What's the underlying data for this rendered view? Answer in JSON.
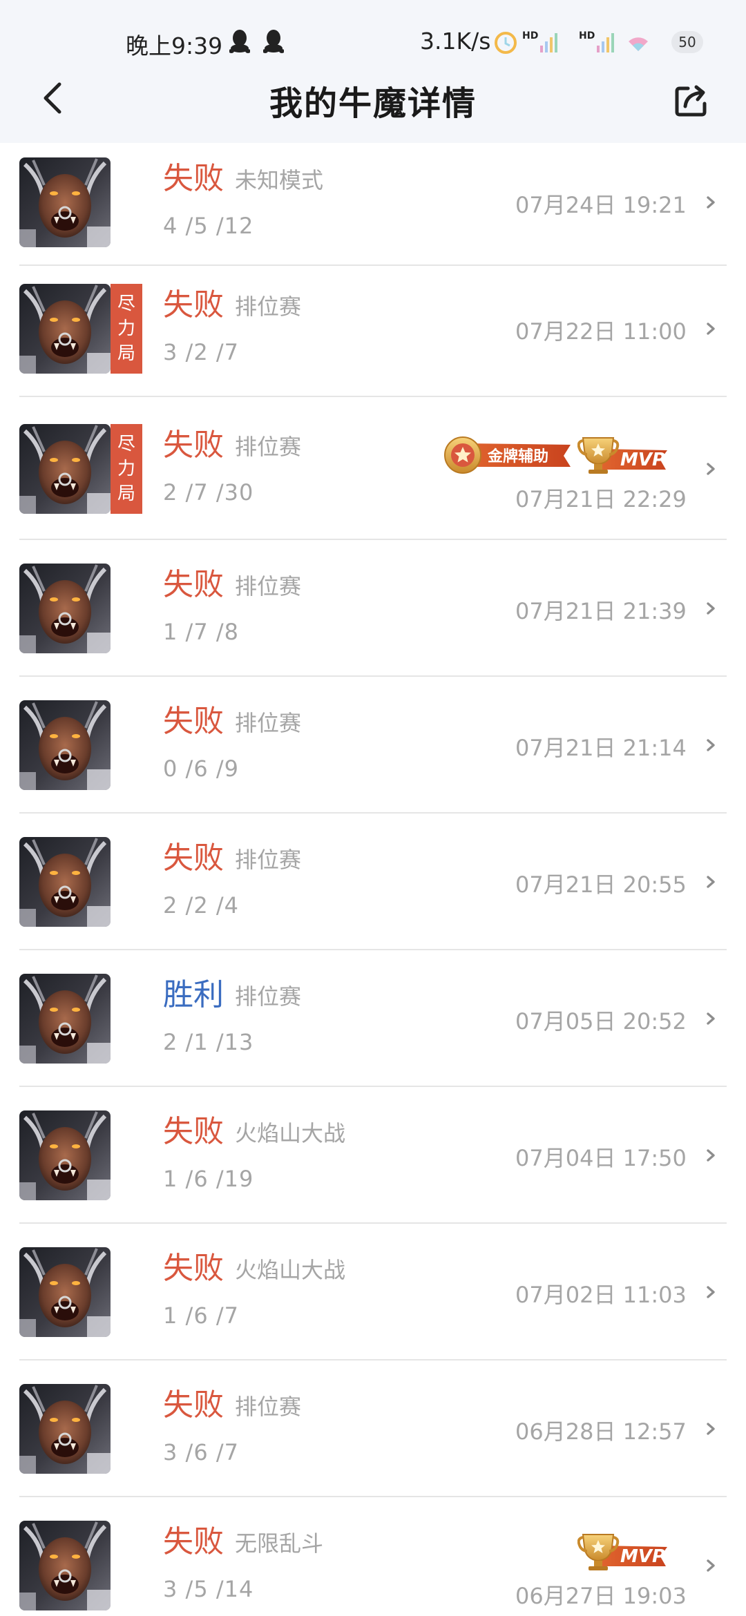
{
  "status_bar": {
    "time": "晚上9:39",
    "net_speed": "3.1K/s",
    "battery": "50"
  },
  "nav": {
    "title": "我的牛魔详情"
  },
  "badges": {
    "effort": [
      "尽",
      "力",
      "局"
    ],
    "gold_support": "金牌辅助",
    "mvp": "MVP"
  },
  "colors": {
    "loss": "#d9573e",
    "win": "#3a6cc0",
    "muted_text": "#a5a5a5",
    "header_bg": "#f4f6fa"
  },
  "matches": [
    {
      "result": "失败",
      "mode": "未知模式",
      "kda": "4 /5 /12",
      "datetime": "07月24日 19:21",
      "effort": false,
      "medals": []
    },
    {
      "result": "失败",
      "mode": "排位赛",
      "kda": "3 /2 /7",
      "datetime": "07月22日 11:00",
      "effort": true,
      "medals": []
    },
    {
      "result": "失败",
      "mode": "排位赛",
      "kda": "2 /7 /30",
      "datetime": "07月21日 22:29",
      "effort": true,
      "medals": [
        "gold_support",
        "mvp"
      ]
    },
    {
      "result": "失败",
      "mode": "排位赛",
      "kda": "1 /7 /8",
      "datetime": "07月21日 21:39",
      "effort": false,
      "medals": []
    },
    {
      "result": "失败",
      "mode": "排位赛",
      "kda": "0 /6 /9",
      "datetime": "07月21日 21:14",
      "effort": false,
      "medals": []
    },
    {
      "result": "失败",
      "mode": "排位赛",
      "kda": "2 /2 /4",
      "datetime": "07月21日 20:55",
      "effort": false,
      "medals": []
    },
    {
      "result": "胜利",
      "mode": "排位赛",
      "kda": "2 /1 /13",
      "datetime": "07月05日 20:52",
      "effort": false,
      "medals": []
    },
    {
      "result": "失败",
      "mode": "火焰山大战",
      "kda": "1 /6 /19",
      "datetime": "07月04日 17:50",
      "effort": false,
      "medals": []
    },
    {
      "result": "失败",
      "mode": "火焰山大战",
      "kda": "1 /6 /7",
      "datetime": "07月02日 11:03",
      "effort": false,
      "medals": []
    },
    {
      "result": "失败",
      "mode": "排位赛",
      "kda": "3 /6 /7",
      "datetime": "06月28日 12:57",
      "effort": false,
      "medals": []
    },
    {
      "result": "失败",
      "mode": "无限乱斗",
      "kda": "3 /5 /14",
      "datetime": "06月27日 19:03",
      "effort": false,
      "medals": [
        "mvp"
      ]
    }
  ]
}
